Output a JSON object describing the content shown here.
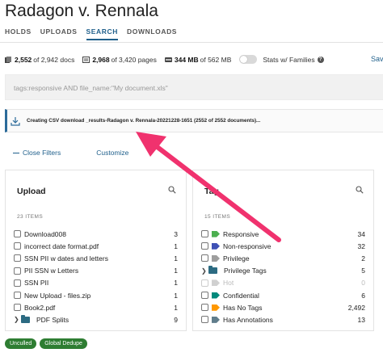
{
  "page_title": "Radagon v. Rennala",
  "tabs": [
    {
      "label": "HOLDS",
      "active": false
    },
    {
      "label": "UPLOADS",
      "active": false
    },
    {
      "label": "SEARCH",
      "active": true
    },
    {
      "label": "DOWNLOADS",
      "active": false
    }
  ],
  "stats": {
    "docs_bold": "2,552",
    "docs_rest": "of 2,942 docs",
    "pages_bold": "2,968",
    "pages_rest": "of 3,420 pages",
    "size_bold": "344 MB",
    "size_rest": "of 562 MB",
    "toggle_label": "Stats w/ Families",
    "save_label": "Sav"
  },
  "search": {
    "query": "tags:responsive AND file_name:\"My document.xls\""
  },
  "download_bar": {
    "icon": "download-icon",
    "text": "Creating CSV download _results-Radagon v. Rennala-20221228-1651 (2552 of 2552 documents)..."
  },
  "filter_actions": {
    "close_label": "Close Filters",
    "customize_label": "Customize"
  },
  "upload_panel": {
    "title": "Upload",
    "count": "23 ITEMS",
    "items": [
      {
        "label": "Download008",
        "count": "3",
        "kind": "checkbox"
      },
      {
        "label": "incorrect date format.pdf",
        "count": "1",
        "kind": "checkbox"
      },
      {
        "label": "SSN PII w dates and letters",
        "count": "1",
        "kind": "checkbox"
      },
      {
        "label": "PII SSN w Letters",
        "count": "1",
        "kind": "checkbox"
      },
      {
        "label": "SSN PII",
        "count": "1",
        "kind": "checkbox"
      },
      {
        "label": "New Upload - files.zip",
        "count": "1",
        "kind": "checkbox"
      },
      {
        "label": "Book2.pdf",
        "count": "1",
        "kind": "checkbox"
      },
      {
        "label": "PDF Splits",
        "count": "9",
        "kind": "folder"
      }
    ]
  },
  "tags_panel": {
    "title": "Tag",
    "count": "15 ITEMS",
    "items": [
      {
        "label": "Responsive",
        "count": "34",
        "kind": "tag",
        "color": "#4caf50"
      },
      {
        "label": "Non-responsive",
        "count": "32",
        "kind": "tag",
        "color": "#3f51b5"
      },
      {
        "label": "Privilege",
        "count": "2",
        "kind": "tag",
        "color": "#9e9e9e"
      },
      {
        "label": "Privilege Tags",
        "count": "5",
        "kind": "folder"
      },
      {
        "label": "Hot",
        "count": "0",
        "kind": "tag",
        "color": "#d0d0d0",
        "disabled": true
      },
      {
        "label": "Confidential",
        "count": "6",
        "kind": "tag",
        "color": "#00897b"
      },
      {
        "label": "Has No Tags",
        "count": "2,492",
        "kind": "tag",
        "color": "#ff9800"
      },
      {
        "label": "Has Annotations",
        "count": "13",
        "kind": "tag",
        "color": "#607d8b"
      }
    ]
  },
  "chips": [
    "Unculled",
    "Global Dedupe"
  ],
  "colors": {
    "accent": "#1f5f8b",
    "arrow": "#f0326e",
    "chip": "#2e7d32"
  }
}
